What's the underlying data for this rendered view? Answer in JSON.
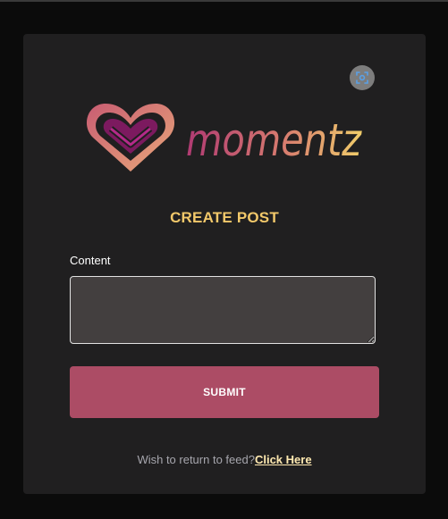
{
  "brand": {
    "name": "momentz",
    "colors": {
      "mark_outer": "#d87a74",
      "mark_inner": "#8f1f6e",
      "text_gradient_start": "#b03a72",
      "text_gradient_end": "#f0cd6a"
    }
  },
  "header": {
    "scan_icon": "scan-icon"
  },
  "form": {
    "title": "CREATE POST",
    "content_label": "Content",
    "content_value": "",
    "submit_label": "SUBMIT"
  },
  "footer": {
    "prompt": "Wish to return to feed?",
    "link_label": "Click Here"
  },
  "colors": {
    "page_bg": "#0b0b0b",
    "card_bg": "#201f20",
    "title": "#f2c86a",
    "submit_bg": "#ac4c65",
    "textarea_bg": "#433f3f",
    "link": "#ffe9b0"
  }
}
